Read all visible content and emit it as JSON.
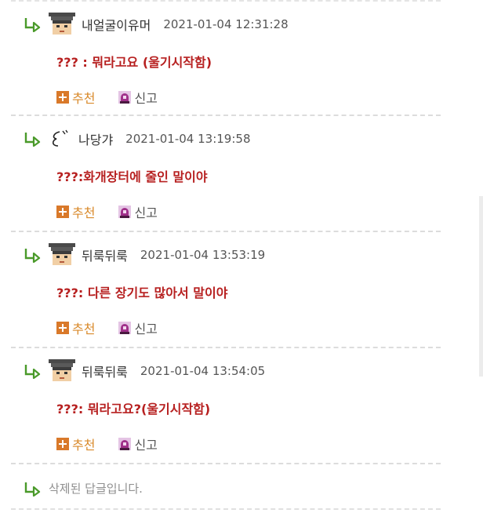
{
  "replies": [
    {
      "nickname": "내얼굴이유머",
      "date": "2021-01-04 12:31:28",
      "comment": "??? : 뭐라고요 (울기시작함)",
      "avatar": "pixel-face-icon"
    },
    {
      "nickname": "나당갸",
      "date": "2021-01-04 13:19:58",
      "comment": "???:화개장터에 줄인 말이야",
      "avatar": "signature-icon"
    },
    {
      "nickname": "뒤룩뒤룩",
      "date": "2021-01-04 13:53:19",
      "comment": "???: 다른 장기도 많아서 말이야",
      "avatar": "pixel-face-icon"
    },
    {
      "nickname": "뒤룩뒤룩",
      "date": "2021-01-04 13:54:05",
      "comment": "???: 뭐라고요?(울기시작함)",
      "avatar": "pixel-face-icon"
    }
  ],
  "actions": {
    "recommend_label": "추천",
    "report_label": "신고"
  },
  "deleted_reply_text": "삭제된 답글입니다.",
  "colors": {
    "comment": "#b72020",
    "recommend": "#d98a2b",
    "reply_arrow": "#4a9a2a",
    "report_icon": "#a0308a",
    "divider": "#dcdcdc"
  }
}
